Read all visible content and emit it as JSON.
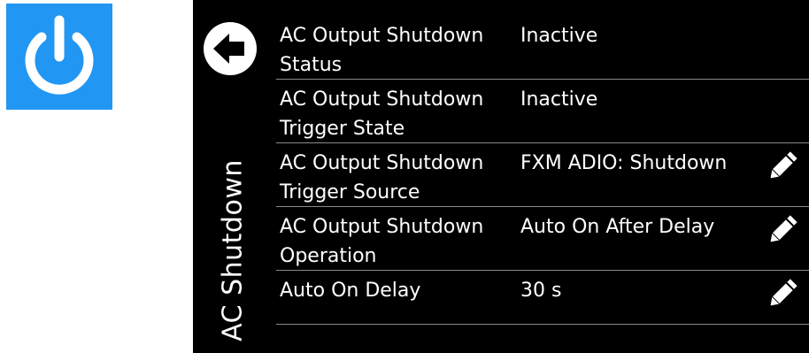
{
  "app": {
    "icon": "power-icon",
    "tile_color": "#2196f3"
  },
  "panel": {
    "title": "AC Shutdown",
    "back_icon": "back-arrow-icon"
  },
  "settings": [
    {
      "label": "AC Output Shutdown Status",
      "value": "Inactive",
      "editable": false
    },
    {
      "label": "AC Output Shutdown Trigger State",
      "value": "Inactive",
      "editable": false
    },
    {
      "label": "AC Output Shutdown Trigger Source",
      "value": "FXM ADIO: Shutdown",
      "editable": true
    },
    {
      "label": "AC Output Shutdown Operation",
      "value": "Auto On After Delay",
      "editable": true
    },
    {
      "label": "Auto On Delay",
      "value": "30 s",
      "editable": true
    }
  ]
}
